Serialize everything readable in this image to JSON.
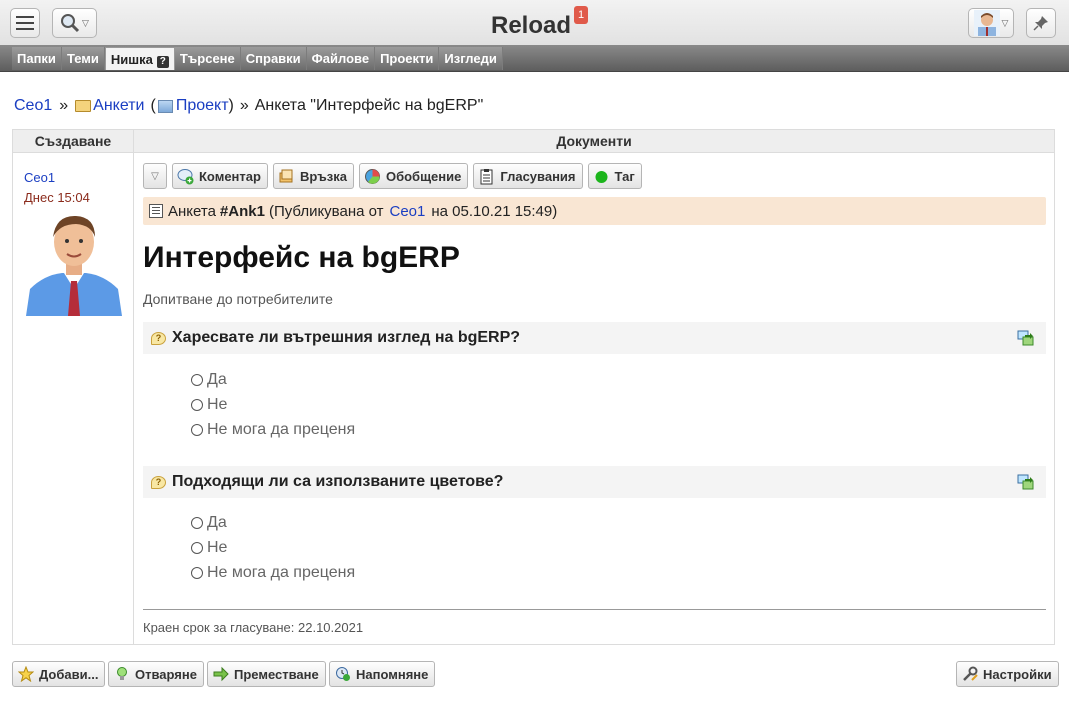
{
  "header": {
    "title": "Reload",
    "notification_count": "1"
  },
  "tabs": [
    {
      "label": "Папки"
    },
    {
      "label": "Теми"
    },
    {
      "label": "Нишка",
      "help": "?"
    },
    {
      "label": "Търсене"
    },
    {
      "label": "Справки"
    },
    {
      "label": "Файлове"
    },
    {
      "label": "Проекти"
    },
    {
      "label": "Изгледи"
    }
  ],
  "breadcrumb": {
    "user": "Ceo1",
    "sep1": "»",
    "folder": "Анкети",
    "open_paren": "(",
    "project": "Проект",
    "close_paren": ")",
    "sep2": "»",
    "current": "Анкета \"Интерфейс на bgERP\""
  },
  "table": {
    "col_create": "Създаване",
    "col_docs": "Документи"
  },
  "author": {
    "name": "Ceo1",
    "time": "Днес 15:04"
  },
  "toolbar": {
    "comment": "Коментар",
    "link": "Връзка",
    "summary": "Обобщение",
    "votes": "Гласувания",
    "tag": "Таг"
  },
  "document": {
    "type": "Анкета",
    "number": "#Ank1",
    "published_prefix": "(Публикувана от",
    "published_by": "Ceo1",
    "published_suffix": "на 05.10.21 15:49)",
    "title": "Интерфейс на bgERP",
    "subtitle": "Допитване до потребителите",
    "deadline": "Краен срок за гласуване: 22.10.2021"
  },
  "questions": [
    {
      "text": "Харесвате ли вътрешния изглед на bgERP?",
      "options": [
        "Да",
        "Не",
        "Не мога да преценя"
      ]
    },
    {
      "text": "Подходящи ли са използваните цветове?",
      "options": [
        "Да",
        "Не",
        "Не мога да преценя"
      ]
    }
  ],
  "bottom": {
    "add": "Добави...",
    "reopen": "Отваряне",
    "move": "Преместване",
    "remind": "Напомняне",
    "settings": "Настройки"
  },
  "colors": {
    "link": "#1a3ec2",
    "doc_header_bg": "#f9e6d3",
    "badge": "#e05a4a",
    "tabbar": "#6c6c6c"
  }
}
